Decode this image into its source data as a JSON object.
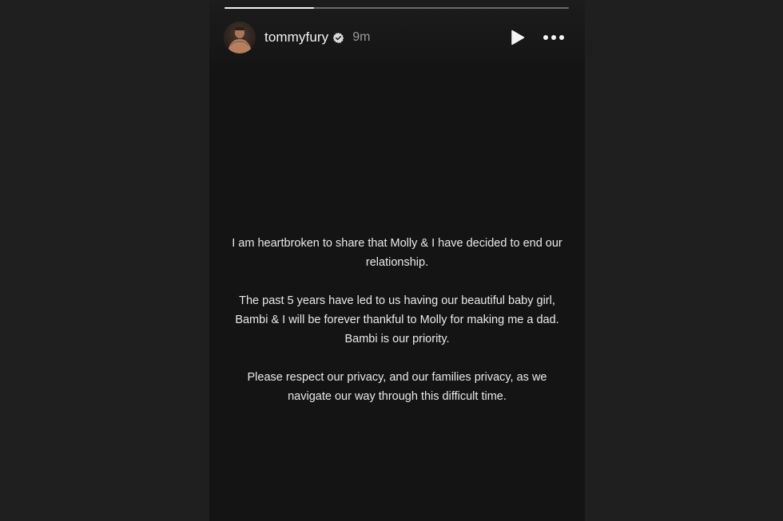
{
  "story": {
    "progress": 0.26,
    "username": "tommyfury",
    "verified": true,
    "time_ago": "9m",
    "avatar_icon": "profile-photo",
    "controls": {
      "play_icon": "play-icon",
      "more_icon": "more-options-icon"
    },
    "paragraphs": [
      "I am heartbroken to share that Molly & I have decided to end our relationship.",
      "The past 5 years have led to us having our beautiful baby girl, Bambi & I will be forever thankful to Molly for making me a dad. Bambi is our priority.",
      "Please respect our privacy, and our families privacy, as we navigate our way through this difficult time."
    ]
  },
  "colors": {
    "page_background": "#1f1f1f",
    "story_background": "#141414",
    "text": "#eaeaea",
    "verified_badge": "#d8d8d8"
  }
}
